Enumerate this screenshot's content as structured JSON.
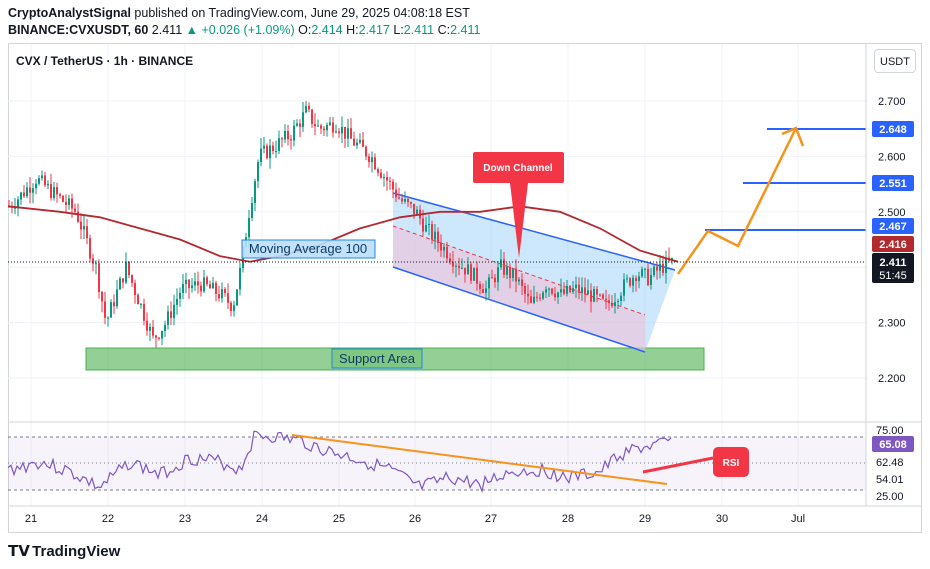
{
  "header": {
    "publisher": "CryptoAnalystSignal",
    "published_text": " published on TradingView.com, June 29, 2025 04:08:18 EST",
    "symbol": "BINANCE:CVXUSDT, 60",
    "last": "2.411",
    "change": "+0.026 (+1.09%)",
    "ohlc_o_label": "O:",
    "ohlc_o": "2.414",
    "ohlc_h_label": "H:",
    "ohlc_h": "2.417",
    "ohlc_l_label": "L:",
    "ohlc_l": "2.411",
    "ohlc_c_label": "C:",
    "ohlc_c": "2.411"
  },
  "chart": {
    "title": "CVX / TetherUS · 1h · BINANCE",
    "currency_button": "USDT",
    "price_ticks": [
      "2.700",
      "2.600",
      "2.500",
      "2.300",
      "2.200"
    ],
    "target_labels": [
      "2.648",
      "2.551",
      "2.467"
    ],
    "ma_label_price": "2.416",
    "last_price": "2.411",
    "countdown": "51:45",
    "date_ticks": [
      "21",
      "22",
      "23",
      "24",
      "25",
      "26",
      "27",
      "28",
      "29",
      "30",
      "Jul"
    ],
    "annotations": {
      "moving_average": "Moving Average 100",
      "support": "Support Area",
      "down_channel": "Down Channel",
      "rsi": "RSI"
    },
    "rsi_ticks": [
      "75.00",
      "62.48",
      "54.01",
      "25.00"
    ],
    "rsi_value": "65.08",
    "colors": {
      "up": "#089981",
      "down": "#f23645",
      "ma": "#b2292e",
      "channel_blue": "#2962ff",
      "support_green": "#4caf50",
      "projection": "#f7931a",
      "rsi_line": "#7e57c2"
    }
  },
  "footer": {
    "brand": "TradingView"
  }
}
